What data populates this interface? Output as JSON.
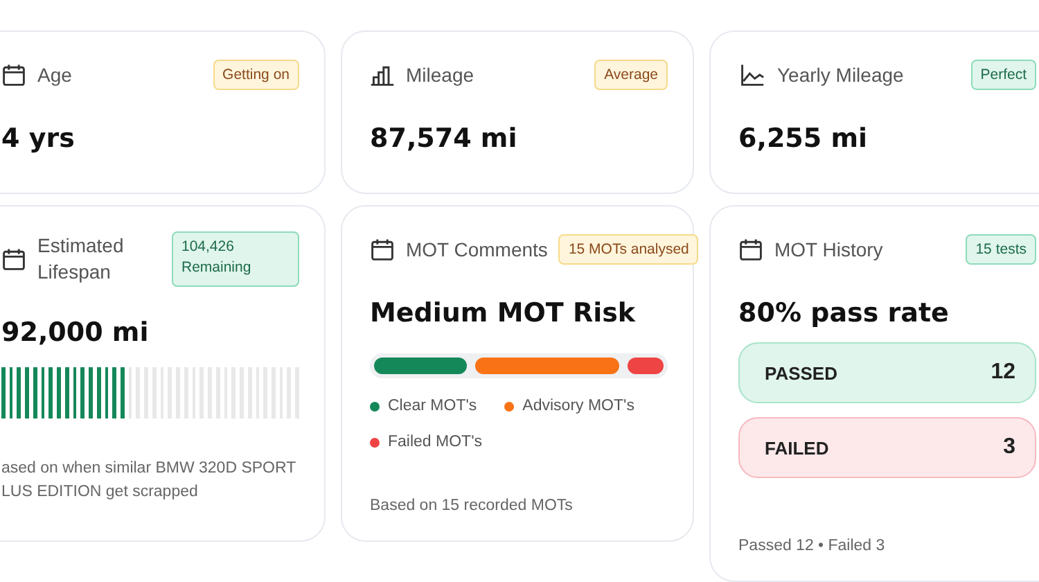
{
  "stats": [
    {
      "title": "Age",
      "badge": {
        "text": "Getting on",
        "color": "#f6da8a"
      },
      "value": "4 yrs"
    },
    {
      "title": "Mileage",
      "badge": {
        "text": "Average",
        "color": "#f6da8a"
      },
      "value": "87,574 mi"
    },
    {
      "title": "Yearly Mileage",
      "badge": {
        "text": "Perfect",
        "color": "#8ddcb9"
      },
      "value": "6,255 mi"
    }
  ],
  "lifespan": {
    "title": "Estimated Lifespan",
    "badge": {
      "text": "104,426 Remaining",
      "color": "#8ddcb9"
    },
    "value": "92,000 mi",
    "level": 0.42,
    "note_lines": [
      "ased on when similar BMW 320D SPORT",
      "LUS EDITION get scrapped"
    ]
  },
  "mot_comments": {
    "title": "MOT Comments",
    "badge": {
      "text": "15 MOTs analysed",
      "color": "#f6da8a"
    },
    "heading": "Medium MOT Risk",
    "segments": [
      {
        "label": "Clear MOT's",
        "color": "#15885a"
      },
      {
        "label": "Advisory MOT's",
        "color": "#f97316"
      },
      {
        "label": "Failed MOT's",
        "color": "#ef4444"
      }
    ],
    "note": "Based on 15 recorded MOTs"
  },
  "mot_history": {
    "title": "MOT History",
    "badge": {
      "text": "15 tests",
      "color": "#8ddcb9"
    },
    "heading": "80% pass rate",
    "results": [
      {
        "label": "PASSED",
        "count": "12",
        "kind": "pass"
      },
      {
        "label": "FAILED",
        "count": "3",
        "kind": "fail"
      }
    ],
    "note": "Passed 12 • Failed 3"
  }
}
